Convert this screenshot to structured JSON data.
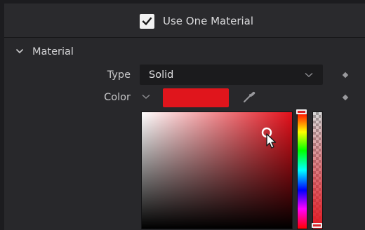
{
  "use_one_material": {
    "label": "Use One Material",
    "checked": true
  },
  "material_section": {
    "title": "Material",
    "expanded": true
  },
  "type_field": {
    "label": "Type",
    "value": "Solid"
  },
  "color_field": {
    "label": "Color",
    "swatch_color": "#e0151c"
  },
  "color_picker": {
    "field_hue_color": "#e3101a",
    "hue_level": 0,
    "alpha_level": 1
  },
  "icons": {
    "checkbox": "checkmark-icon",
    "section_toggle": "chevron-down-icon",
    "dropdown": "chevron-down-icon",
    "keyframe": "diamond-icon",
    "eyedropper": "eyedropper-icon",
    "cursor": "mouse-pointer-icon"
  }
}
